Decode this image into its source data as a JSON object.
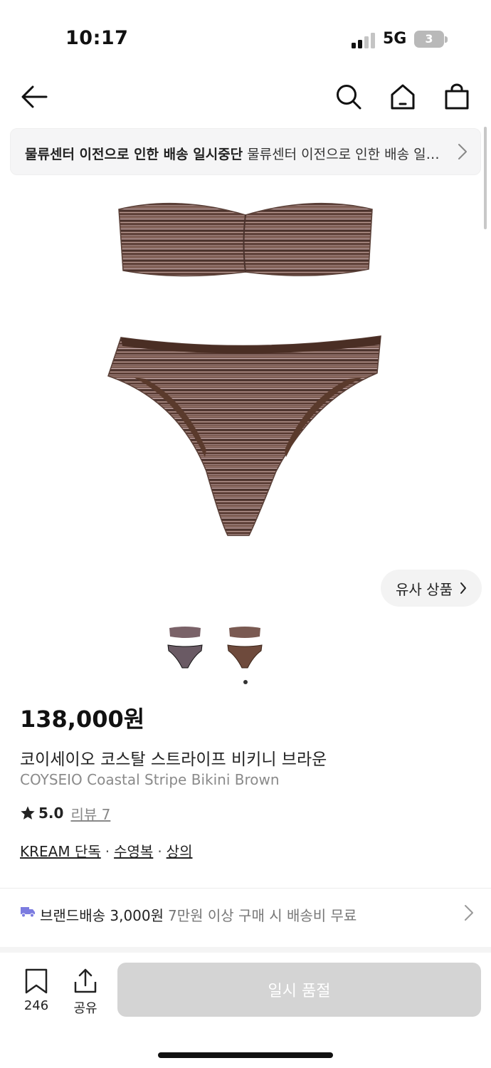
{
  "status_bar": {
    "time": "10:17",
    "network": "5G",
    "battery": "3"
  },
  "notice": {
    "title": "물류센터 이전으로 인한 배송 일시중단",
    "body": "물류센터 이전으로 인한 배송 일시중단 안내"
  },
  "similar_button": {
    "label": "유사 상품"
  },
  "product": {
    "price": "138,000원",
    "name_ko": "코이세이오 코스탈 스트라이프 비키니 브라운",
    "name_en": "COYSEIO Coastal Stripe Bikini Brown",
    "rating": "5.0",
    "review_label": "리뷰 7",
    "tags": [
      "KREAM 단독",
      "수영복",
      "상의"
    ]
  },
  "thumbnails": {
    "count": 2,
    "active_index": 1
  },
  "shipping": {
    "label": "브랜드배송 3,000원",
    "sub": "7만원 이상 구매 시 배송비 무료"
  },
  "bottom_bar": {
    "bookmark_count": "246",
    "share_label": "공유",
    "cta_label": "일시 품절"
  },
  "colors": {
    "cta_disabled": "#d4d4d4",
    "ship_icon": "#7c7ce0",
    "fabric_brown": "#6b4a3c"
  }
}
